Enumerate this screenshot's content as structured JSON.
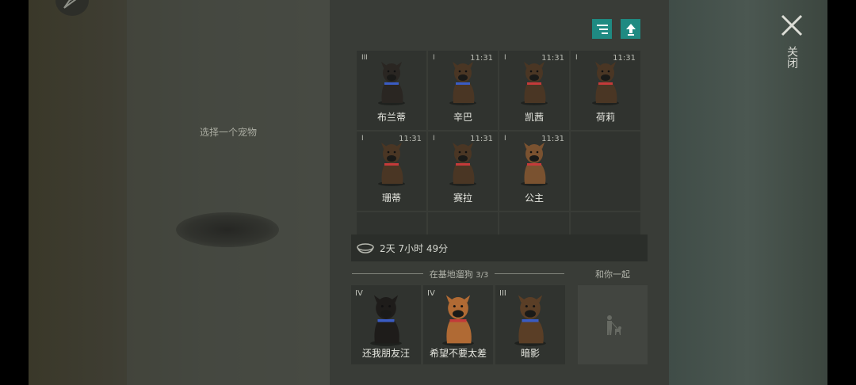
{
  "left": {
    "hint": "选择一个宠物"
  },
  "toolbar": {
    "sort_icon": "sort-icon",
    "upload_icon": "upload-icon"
  },
  "pets": [
    {
      "level": "III",
      "time": "",
      "name": "布兰蒂"
    },
    {
      "level": "I",
      "time": "11:31",
      "name": "辛巴"
    },
    {
      "level": "I",
      "time": "11:31",
      "name": "凯茜"
    },
    {
      "level": "I",
      "time": "11:31",
      "name": "荷莉"
    },
    {
      "level": "I",
      "time": "11:31",
      "name": "珊蒂"
    },
    {
      "level": "I",
      "time": "11:31",
      "name": "赛拉"
    },
    {
      "level": "I",
      "time": "11:31",
      "name": "公主"
    }
  ],
  "timer": {
    "text": "2天 7小时 49分"
  },
  "base": {
    "label": "在基地遛狗",
    "count": "3/3",
    "pets": [
      {
        "level": "IV",
        "name": "还我朋友汪"
      },
      {
        "level": "IV",
        "name": "希望不要太差"
      },
      {
        "level": "III",
        "name": "暗影"
      }
    ]
  },
  "with_you": {
    "label": "和你一起"
  },
  "close": {
    "label": "关闭"
  },
  "colors": {
    "accent": "#1f8a82"
  }
}
